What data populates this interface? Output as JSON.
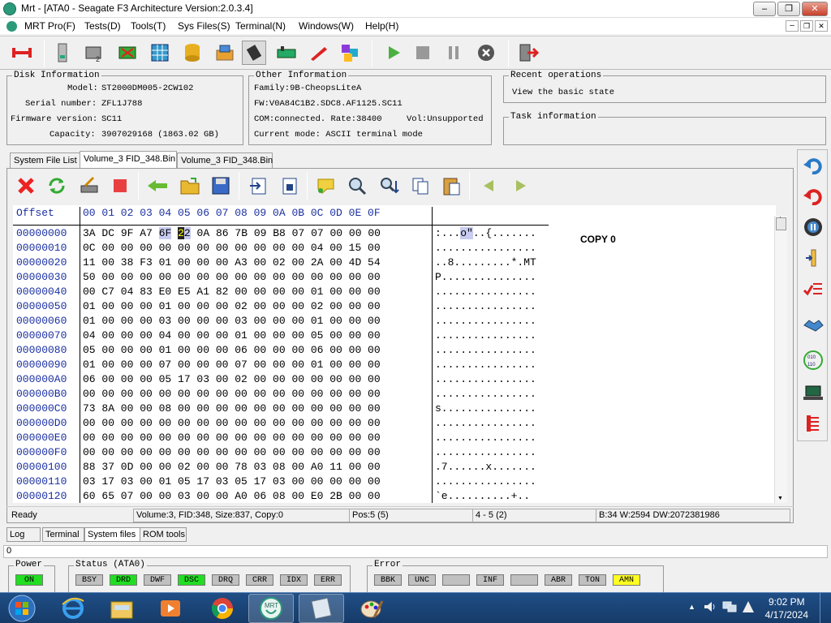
{
  "window": {
    "title": "Mrt - [ATA0 - Seagate F3 Architecture Version:2.0.3.4]"
  },
  "menu": [
    "MRT Pro(F)",
    "Tests(D)",
    "Tools(T)",
    "Sys Files(S)",
    "Terminal(N)",
    "Windows(W)",
    "Help(H)"
  ],
  "disk_info": {
    "title": "Disk Information",
    "rows": [
      {
        "label": "Model:",
        "value": "ST2000DM005-2CW102"
      },
      {
        "label": "Serial number:",
        "value": "ZFL1J788"
      },
      {
        "label": "Firmware version:",
        "value": "SC11"
      },
      {
        "label": "Capacity:",
        "value": "3907029168 (1863.02 GB)"
      }
    ]
  },
  "other_info": {
    "title": "Other Information",
    "family": "Family:9B-CheopsLiteA",
    "fw": "FW:V0A84C1B2.SDC8.AF1125.SC11",
    "com": "COM:connected. Rate:38400",
    "vol": "Vol:Unsupported",
    "mode": "Current mode: ASCII terminal mode"
  },
  "recent_ops": {
    "title": "Recent operations",
    "item": "View the basic state"
  },
  "task_info": {
    "title": "Task information"
  },
  "tabs": [
    "System File List",
    "Volume_3 FID_348.Bin",
    "Volume_3 FID_348.Bin"
  ],
  "hex": {
    "header_offset": "Offset",
    "header_cols": "00 01 02 03 04 05 06 07 08 09 0A 0B 0C 0D 0E 0F",
    "copy_label": "COPY 0",
    "rows": [
      {
        "off": "00000000",
        "bytes": "3A DC 9F A7 6F 22 0A 86 7B 09 B8 07 07 00 00 00",
        "ascii": ":...o\"..{......."
      },
      {
        "off": "00000010",
        "bytes": "0C 00 00 00 00 00 00 00 00 00 00 00 04 00 15 00",
        "ascii": "................"
      },
      {
        "off": "00000020",
        "bytes": "11 00 38 F3 01 00 00 00 A3 00 02 00 2A 00 4D 54",
        "ascii": "..8.........*.MT"
      },
      {
        "off": "00000030",
        "bytes": "50 00 00 00 00 00 00 00 00 00 00 00 00 00 00 00",
        "ascii": "P..............."
      },
      {
        "off": "00000040",
        "bytes": "00 C7 04 83 E0 E5 A1 82 00 00 00 00 01 00 00 00",
        "ascii": "................"
      },
      {
        "off": "00000050",
        "bytes": "01 00 00 00 01 00 00 00 02 00 00 00 02 00 00 00",
        "ascii": "................"
      },
      {
        "off": "00000060",
        "bytes": "01 00 00 00 03 00 00 00 03 00 00 00 01 00 00 00",
        "ascii": "................"
      },
      {
        "off": "00000070",
        "bytes": "04 00 00 00 04 00 00 00 01 00 00 00 05 00 00 00",
        "ascii": "................"
      },
      {
        "off": "00000080",
        "bytes": "05 00 00 00 01 00 00 00 06 00 00 00 06 00 00 00",
        "ascii": "................"
      },
      {
        "off": "00000090",
        "bytes": "01 00 00 00 07 00 00 00 07 00 00 00 01 00 00 00",
        "ascii": "................"
      },
      {
        "off": "000000A0",
        "bytes": "06 00 00 00 05 17 03 00 02 00 00 00 00 00 00 00",
        "ascii": "................"
      },
      {
        "off": "000000B0",
        "bytes": "00 00 00 00 00 00 00 00 00 00 00 00 00 00 00 00",
        "ascii": "................"
      },
      {
        "off": "000000C0",
        "bytes": "73 8A 00 00 08 00 00 00 00 00 00 00 00 00 00 00",
        "ascii": "s..............."
      },
      {
        "off": "000000D0",
        "bytes": "00 00 00 00 00 00 00 00 00 00 00 00 00 00 00 00",
        "ascii": "................"
      },
      {
        "off": "000000E0",
        "bytes": "00 00 00 00 00 00 00 00 00 00 00 00 00 00 00 00",
        "ascii": "................"
      },
      {
        "off": "000000F0",
        "bytes": "00 00 00 00 00 00 00 00 00 00 00 00 00 00 00 00",
        "ascii": "................"
      },
      {
        "off": "00000100",
        "bytes": "88 37 0D 00 00 02 00 00 78 03 08 00 A0 11 00 00",
        "ascii": ".7......x......."
      },
      {
        "off": "00000110",
        "bytes": "03 17 03 00 01 05 17 03 05 17 03 00 00 00 00 00",
        "ascii": "................"
      },
      {
        "off": "00000120",
        "bytes": "60 65 07 00 00 03 00 00 A0 06 08 00 E0 2B 00 00",
        "ascii": "`e..........+.."
      }
    ]
  },
  "status": {
    "ready": "Ready",
    "file": "Volume:3, FID:348, Size:837, Copy:0",
    "pos": "Pos:5 (5)",
    "range": "4 - 5 (2)",
    "value": "B:34 W:2594 DW:2072381986"
  },
  "bottom_tabs": [
    "Log",
    "Terminal",
    "System files",
    "ROM tools"
  ],
  "log_line": "0",
  "power": {
    "title": "Power",
    "state": "ON"
  },
  "status_ata": {
    "title": "Status (ATA0)",
    "lamps": [
      {
        "label": "BSY",
        "color": "#c0c0c0"
      },
      {
        "label": "DRD",
        "color": "#22dd22"
      },
      {
        "label": "DWF",
        "color": "#c0c0c0"
      },
      {
        "label": "DSC",
        "color": "#22dd22"
      },
      {
        "label": "DRQ",
        "color": "#c0c0c0"
      },
      {
        "label": "CRR",
        "color": "#c0c0c0"
      },
      {
        "label": "IDX",
        "color": "#c0c0c0"
      },
      {
        "label": "ERR",
        "color": "#c0c0c0"
      }
    ]
  },
  "error": {
    "title": "Error",
    "lamps": [
      {
        "label": "BBK",
        "color": "#c0c0c0"
      },
      {
        "label": "UNC",
        "color": "#c0c0c0"
      },
      {
        "label": "",
        "color": "#c0c0c0"
      },
      {
        "label": "INF",
        "color": "#c0c0c0"
      },
      {
        "label": "",
        "color": "#c0c0c0"
      },
      {
        "label": "ABR",
        "color": "#c0c0c0"
      },
      {
        "label": "TON",
        "color": "#c0c0c0"
      },
      {
        "label": "AMN",
        "color": "#ffff22"
      }
    ]
  },
  "clock": {
    "time": "9:02 PM",
    "date": "4/17/2024"
  }
}
